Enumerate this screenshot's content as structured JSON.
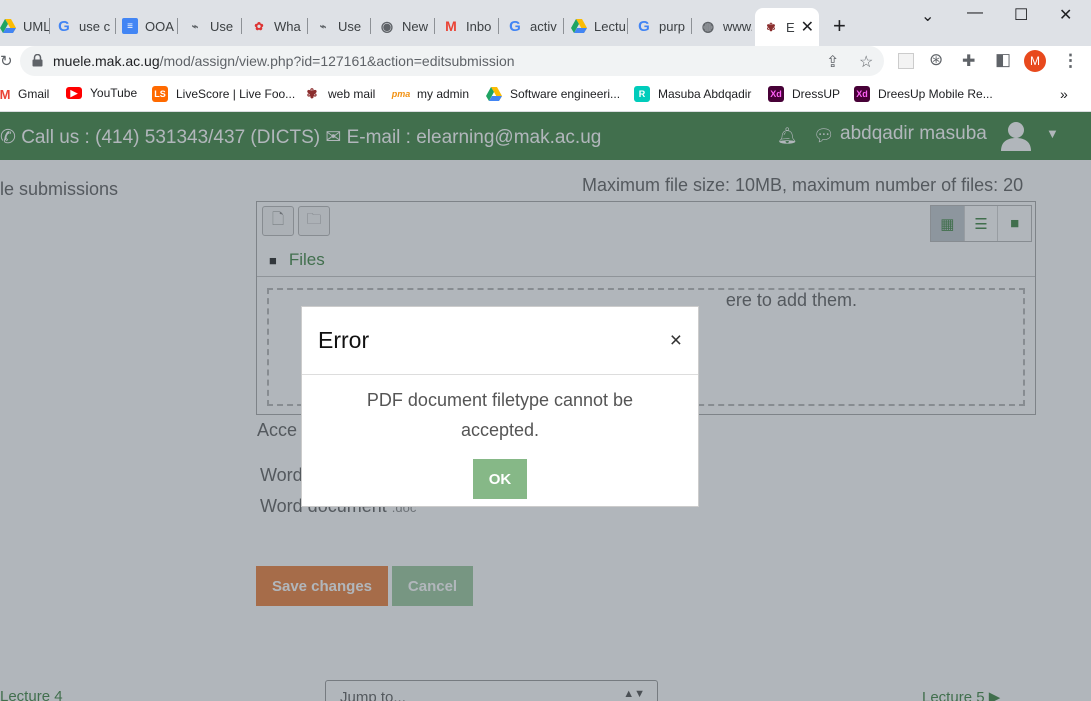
{
  "browser": {
    "tabs": [
      {
        "label": "UML",
        "icon": "google-drive-icon"
      },
      {
        "label": "use c",
        "icon": "google-icon"
      },
      {
        "label": "OOA",
        "icon": "google-docs-icon"
      },
      {
        "label": "Use",
        "icon": "link-icon"
      },
      {
        "label": "Wha",
        "icon": "bird-icon"
      },
      {
        "label": "Use",
        "icon": "link-icon"
      },
      {
        "label": "New",
        "icon": "chrome-icon"
      },
      {
        "label": "Inbo",
        "icon": "gmail-icon"
      },
      {
        "label": "activ",
        "icon": "google-icon"
      },
      {
        "label": "Lectu",
        "icon": "google-drive-icon"
      },
      {
        "label": "purp",
        "icon": "google-icon"
      },
      {
        "label": "www.",
        "icon": "globe-icon"
      },
      {
        "label": "E",
        "icon": "makerere-icon"
      }
    ],
    "url_host": "muele.mak.ac.ug",
    "url_path": "/mod/assign/view.php?id=127161&action=editsubmission",
    "profile_initial": "M",
    "bookmarks": [
      {
        "label": "Gmail",
        "icon": "gmail-icon",
        "color": "#ea4335"
      },
      {
        "label": "YouTube",
        "icon": "youtube-icon",
        "color": "#ff0000"
      },
      {
        "label": "LiveScore | Live Foo...",
        "icon": "livescore-icon",
        "color": "#ff6a00"
      },
      {
        "label": "web mail",
        "icon": "makerere-icon",
        "color": "#444444"
      },
      {
        "label": "my admin",
        "icon": "pma-icon",
        "color": "#f29111"
      },
      {
        "label": "Software engineeri...",
        "icon": "google-drive-icon",
        "color": "#1fa463"
      },
      {
        "label": "Masuba Abdqadir",
        "icon": "researchgate-icon",
        "color": "#00ccbb"
      },
      {
        "label": "DressUP",
        "icon": "adobe-xd-icon",
        "color": "#470137"
      },
      {
        "label": "DreesUp Mobile Re...",
        "icon": "adobe-xd-icon",
        "color": "#470137"
      }
    ],
    "bookmarks_more": "»"
  },
  "header": {
    "contact": "Call us : (414) 531343/437 (DICTS)",
    "email": "E-mail : elearning@mak.ac.ug",
    "username": "abdqadir masuba",
    "bar_color": "#1e7023"
  },
  "form": {
    "section_label": "le submissions",
    "max_info": "Maximum file size: 10MB, maximum number of files: 20",
    "files_path": "Files",
    "drop_text": "ere to add them.",
    "accepted_label": "Acce",
    "file_types": [
      {
        "name": "Word",
        "ext": ""
      },
      {
        "name": "Word document",
        "ext": ".doc"
      }
    ],
    "save_label": "Save changes",
    "cancel_label": "Cancel"
  },
  "footer_nav": {
    "prev": "Lecture 4",
    "jump": "Jump to...",
    "next": "Lecture 5 ▶"
  },
  "dialog": {
    "title": "Error",
    "close": "×",
    "message": "PDF document filetype cannot be accepted.",
    "ok_label": "OK"
  }
}
